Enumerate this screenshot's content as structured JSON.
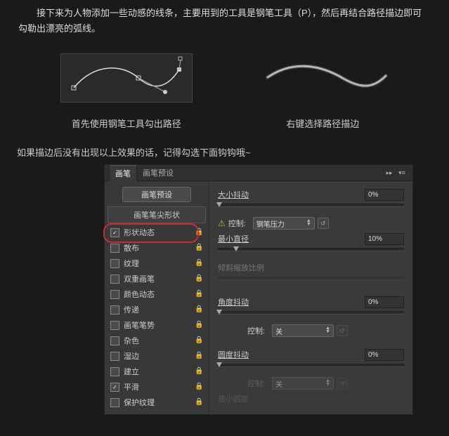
{
  "intro": "　　接下来为人物添加一些动感的线条，主要用到的工具是钢笔工具（P），然后再结合路径描边即可勾勒出漂亮的弧线。",
  "examples": {
    "left_caption": "首先使用钢笔工具勾出路径",
    "right_caption": "右键选择路径描边"
  },
  "note": "如果描边后没有出现以上效果的话，记得勾选下面钩钩哦~",
  "panel": {
    "tabs": {
      "brush": "画笔",
      "presets": "画笔预设"
    },
    "preset_button": "画笔预设",
    "tip_shape": "画笔笔尖形状",
    "options": [
      {
        "label": "形状动态",
        "checked": true,
        "lock": true,
        "highlight": true
      },
      {
        "label": "散布",
        "checked": false,
        "lock": true
      },
      {
        "label": "纹理",
        "checked": false,
        "lock": true
      },
      {
        "label": "双重画笔",
        "checked": false,
        "lock": true
      },
      {
        "label": "颜色动态",
        "checked": false,
        "lock": true
      },
      {
        "label": "传递",
        "checked": false,
        "lock": true
      },
      {
        "label": "画笔笔势",
        "checked": false,
        "lock": true
      },
      {
        "label": "杂色",
        "checked": false,
        "lock": true
      },
      {
        "label": "湿边",
        "checked": false,
        "lock": true
      },
      {
        "label": "建立",
        "checked": false,
        "lock": true
      },
      {
        "label": "平滑",
        "checked": true,
        "lock": true
      },
      {
        "label": "保护纹理",
        "checked": false,
        "lock": true
      }
    ],
    "right": {
      "size_jitter": {
        "label": "大小抖动",
        "value": "0%"
      },
      "control1": {
        "label": "控制:",
        "value": "钢笔压力",
        "warn": true
      },
      "min_diameter": {
        "label": "最小直径",
        "value": "10%"
      },
      "tilt_scale": {
        "label": "倾斜缩放比例"
      },
      "angle_jitter": {
        "label": "角度抖动",
        "value": "0%"
      },
      "control2": {
        "label": "控制:",
        "value": "关"
      },
      "round_jitter": {
        "label": "圆度抖动",
        "value": "0%"
      },
      "control3": {
        "label": "控制:",
        "value": "关"
      },
      "min_round": {
        "label": "最小圆度"
      }
    }
  }
}
